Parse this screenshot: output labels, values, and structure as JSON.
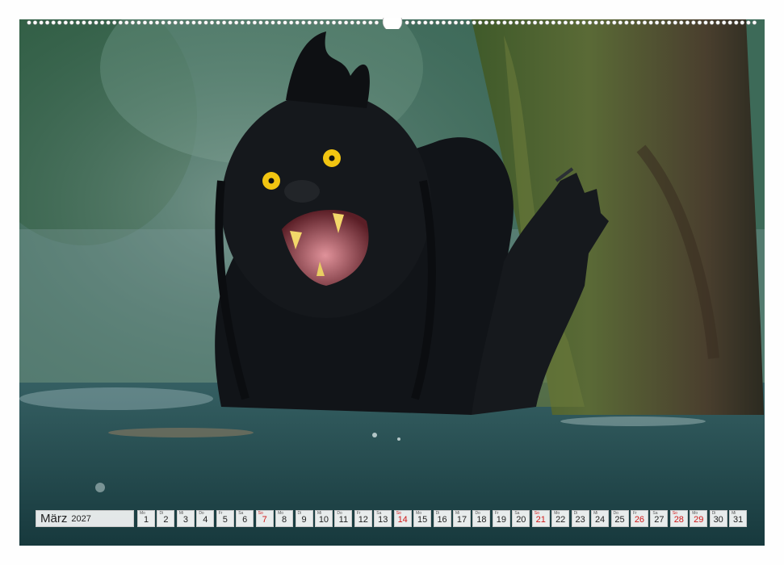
{
  "calendar": {
    "month": "März",
    "year": "2027",
    "days": [
      {
        "wd": "Mo",
        "num": "1",
        "sun": false
      },
      {
        "wd": "Di",
        "num": "2",
        "sun": false
      },
      {
        "wd": "Mi",
        "num": "3",
        "sun": false
      },
      {
        "wd": "Do",
        "num": "4",
        "sun": false
      },
      {
        "wd": "Fr",
        "num": "5",
        "sun": false
      },
      {
        "wd": "Sa",
        "num": "6",
        "sun": false
      },
      {
        "wd": "So",
        "num": "7",
        "sun": true
      },
      {
        "wd": "Mo",
        "num": "8",
        "sun": false
      },
      {
        "wd": "Di",
        "num": "9",
        "sun": false
      },
      {
        "wd": "Mi",
        "num": "10",
        "sun": false
      },
      {
        "wd": "Do",
        "num": "11",
        "sun": false
      },
      {
        "wd": "Fr",
        "num": "12",
        "sun": false
      },
      {
        "wd": "Sa",
        "num": "13",
        "sun": false
      },
      {
        "wd": "So",
        "num": "14",
        "sun": true
      },
      {
        "wd": "Mo",
        "num": "15",
        "sun": false
      },
      {
        "wd": "Di",
        "num": "16",
        "sun": false
      },
      {
        "wd": "Mi",
        "num": "17",
        "sun": false
      },
      {
        "wd": "Do",
        "num": "18",
        "sun": false
      },
      {
        "wd": "Fr",
        "num": "19",
        "sun": false
      },
      {
        "wd": "Sa",
        "num": "20",
        "sun": false
      },
      {
        "wd": "So",
        "num": "21",
        "sun": true
      },
      {
        "wd": "Mo",
        "num": "22",
        "sun": false
      },
      {
        "wd": "Di",
        "num": "23",
        "sun": false
      },
      {
        "wd": "Mi",
        "num": "24",
        "sun": false
      },
      {
        "wd": "Do",
        "num": "25",
        "sun": false
      },
      {
        "wd": "Fr",
        "num": "26",
        "sun": false,
        "hol": true
      },
      {
        "wd": "Sa",
        "num": "27",
        "sun": false
      },
      {
        "wd": "So",
        "num": "28",
        "sun": true
      },
      {
        "wd": "Mo",
        "num": "29",
        "sun": false,
        "hol": true
      },
      {
        "wd": "Di",
        "num": "30",
        "sun": false
      },
      {
        "wd": "Mi",
        "num": "31",
        "sun": false
      }
    ]
  },
  "colors": {
    "sunday": "#d01818",
    "fur": "#111418",
    "eyes": "#f2c511",
    "water": "#1f4d52",
    "moss": "#4e6a2a"
  },
  "icons": [
    "spiral-binding",
    "monster-photo"
  ]
}
